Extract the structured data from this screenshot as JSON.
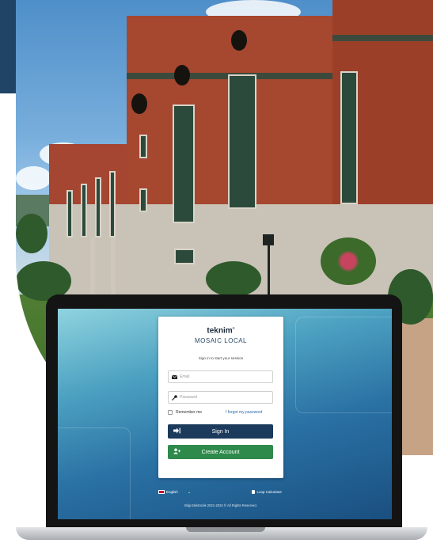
{
  "login": {
    "brand": "teknim",
    "brand_mark": "®",
    "product": "MOSAIC LOCAL",
    "subtitle": "Sign in to start your session",
    "email_placeholder": "Email",
    "password_placeholder": "Password",
    "remember_label": "Remember me",
    "forgot_label": "I forgot my password",
    "signin_label": "Sign In",
    "create_label": "Create Account"
  },
  "footer": {
    "language": "English",
    "loop_calculator": "Loop Calculator",
    "copyright": "Bilgi Elektronik 2021-2024 © All Rights Reserved."
  },
  "icons": {
    "email": "envelope-icon",
    "password": "key-icon",
    "signin": "sign-in-icon",
    "create": "user-plus-icon",
    "language": "uk-flag-icon",
    "chevron": "chevron-down-icon",
    "calculator": "calculator-icon"
  },
  "colors": {
    "banner": "#1f4466",
    "signin_button": "#1b3a5c",
    "create_button": "#2e8a4a",
    "link": "#2a6ab3"
  }
}
